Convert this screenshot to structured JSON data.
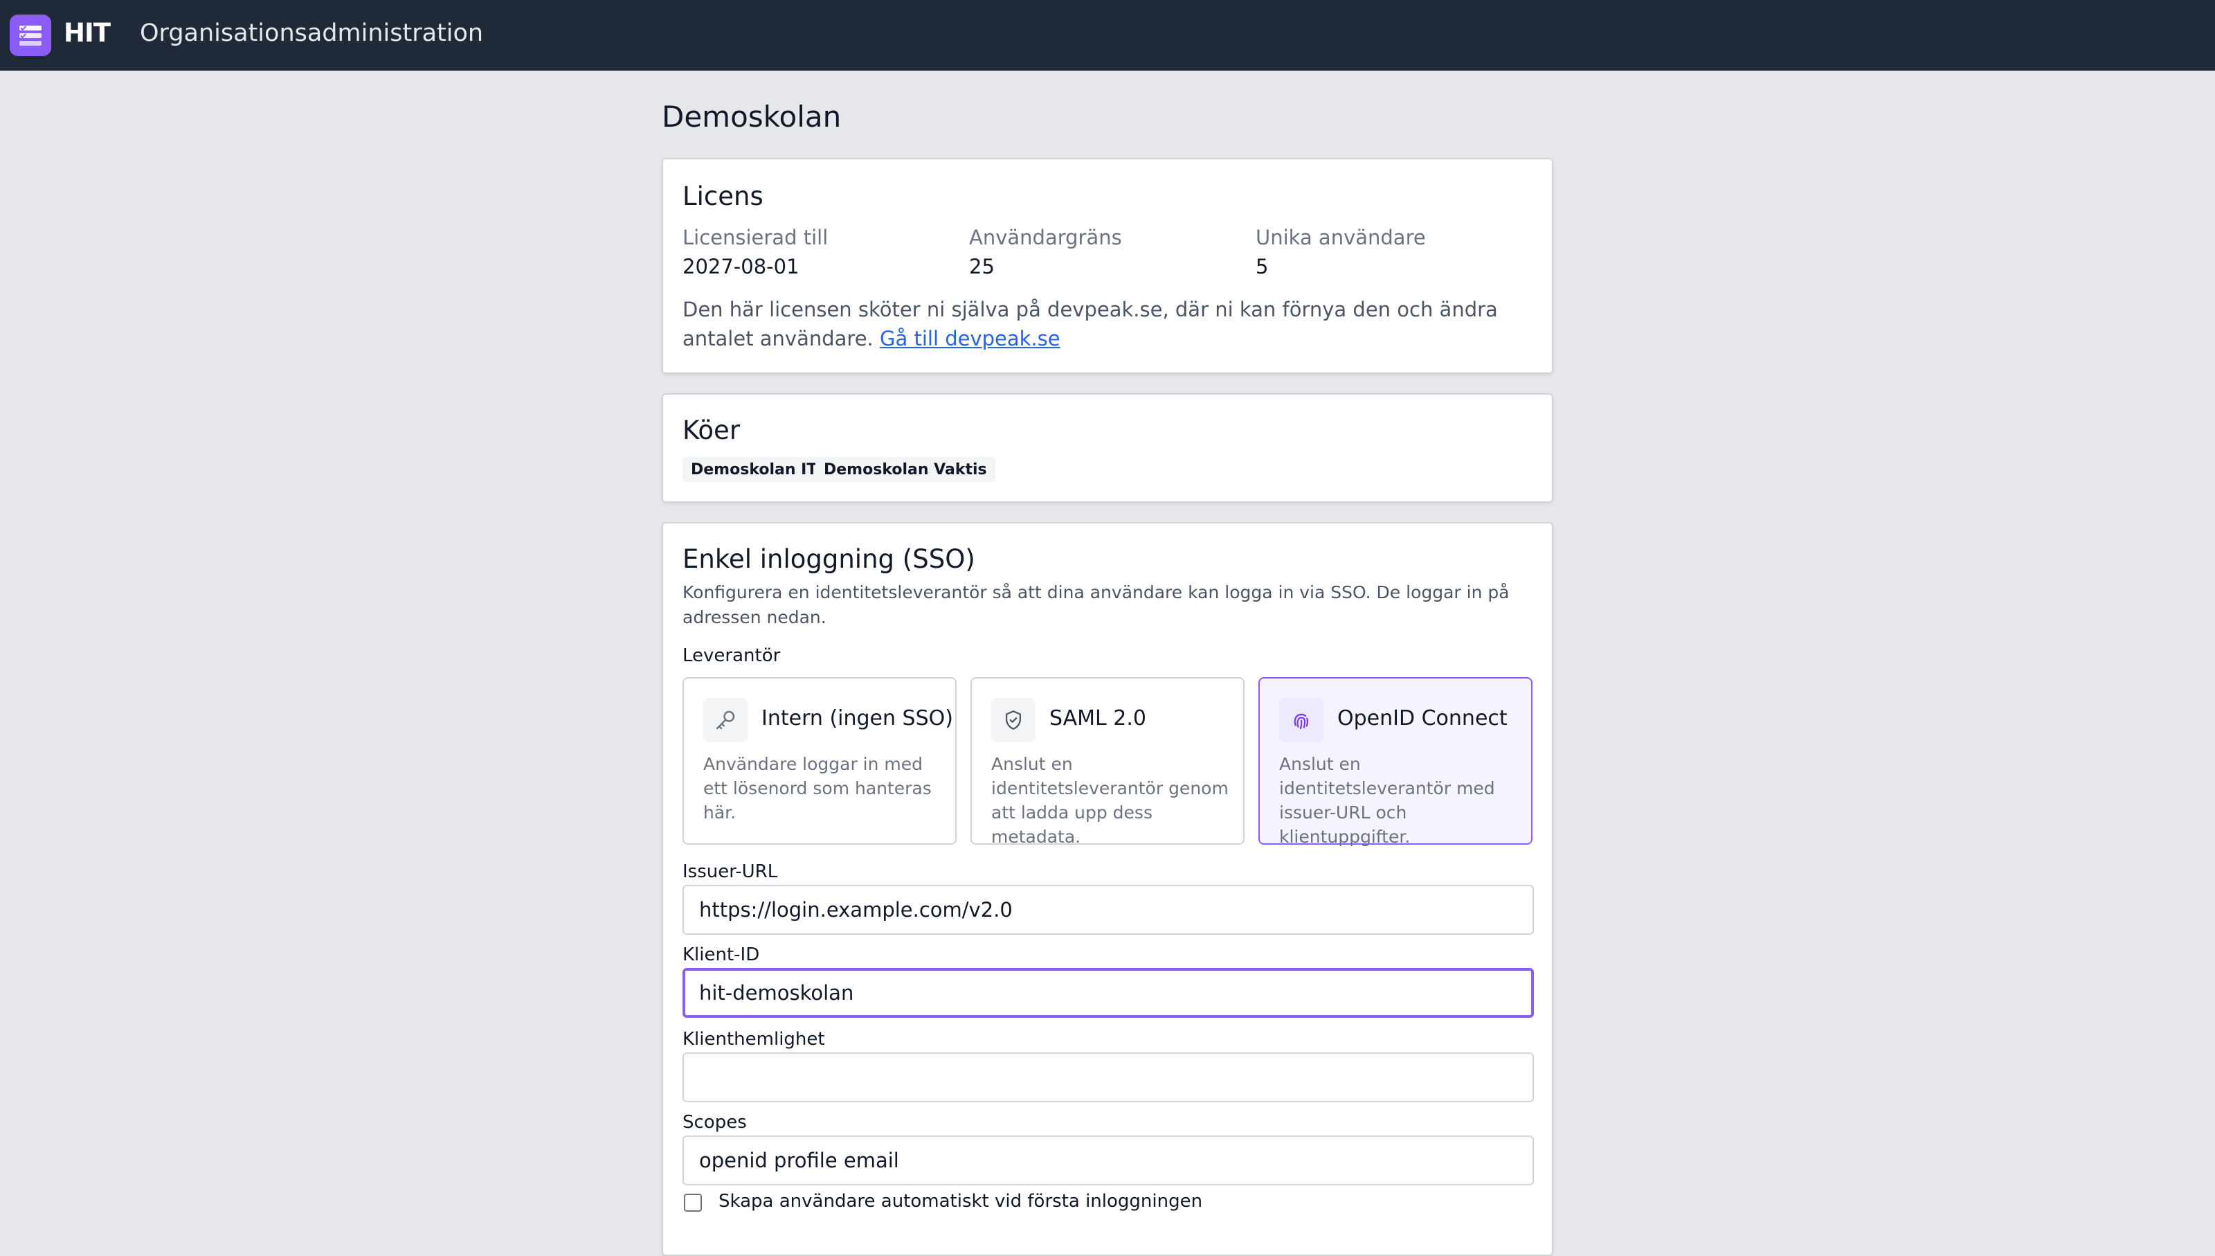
{
  "header": {
    "brand": "HIT",
    "title": "Organisationsadministration"
  },
  "page": {
    "title": "Demoskolan"
  },
  "license": {
    "title": "Licens",
    "fields": [
      {
        "label": "Licensierad till",
        "value": "2027-08-01"
      },
      {
        "label": "Användargräns",
        "value": "25"
      },
      {
        "label": "Unika användare",
        "value": "5"
      }
    ],
    "note": "Den här licensen sköter ni själva på devpeak.se, där ni kan förnya den och ändra antalet användare. ",
    "link": "Gå till devpeak.se"
  },
  "queues": {
    "title": "Köer",
    "tags": [
      "Demoskolan IT",
      "Demoskolan Vaktis"
    ]
  },
  "sso": {
    "title": "Enkel inloggning (SSO)",
    "description": "Konfigurera en identitetsleverantör så att dina användare kan logga in via SSO. De loggar in på adressen nedan.",
    "provider_label": "Leverantör",
    "providers": [
      {
        "title": "Intern (ingen SSO)",
        "description": "Användare loggar in med ett lösenord som hanteras här.",
        "icon": "key-icon",
        "selected": false
      },
      {
        "title": "SAML 2.0",
        "description": "Anslut en identitetsleverantör genom att ladda upp dess metadata.",
        "icon": "shield-icon",
        "selected": false
      },
      {
        "title": "OpenID Connect",
        "description": "Anslut en identitetsleverantör med issuer-URL och klientuppgifter.",
        "icon": "fingerprint-icon",
        "selected": true
      }
    ],
    "issuer_label": "Issuer-URL",
    "issuer_value": "https://login.example.com/v2.0",
    "client_id_label": "Klient-ID",
    "client_id_value": "hit-demoskolan",
    "secret_label": "Klienthemlighet",
    "secret_value": "",
    "scopes_label": "Scopes",
    "scopes_value": "openid profile email",
    "auto_create_label": "Skapa användare automatiskt vid första inloggningen"
  },
  "colors": {
    "header_bg": "#1f2937",
    "accent": "#8b5cf6",
    "page_bg": "#e5e7eb",
    "link": "#2563eb"
  }
}
